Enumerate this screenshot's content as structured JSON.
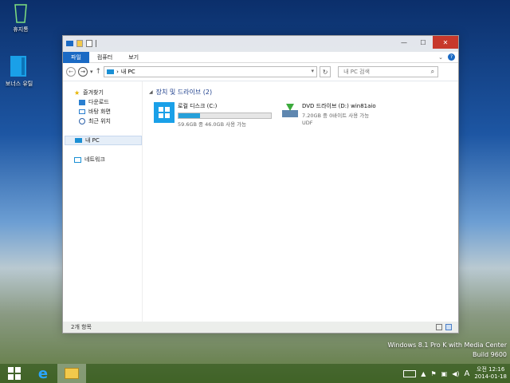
{
  "desktop": {
    "icons": [
      {
        "label": "휴지통",
        "icon": "recycle-bin-icon"
      },
      {
        "label": "보너스 유틸",
        "icon": "folder-blue-icon"
      }
    ]
  },
  "window": {
    "title_icons": [
      "this-pc-icon",
      "properties-icon",
      "new-folder-icon"
    ],
    "controls": {
      "minimize": "—",
      "maximize": "☐",
      "close": "✕"
    },
    "ribbon_tabs": [
      "파일",
      "컴퓨터",
      "보기"
    ],
    "address": {
      "back": "←",
      "forward": "→",
      "history": "▾",
      "up": "↑",
      "path_sep": "›",
      "path": "내 PC",
      "dropdown": "▾",
      "refresh": "↻"
    },
    "search": {
      "placeholder": "내 PC 검색",
      "icon": "⌕"
    },
    "nav_pane": {
      "favorites": "즐겨찾기",
      "favorites_items": [
        "다운로드",
        "바탕 화면",
        "최근 위치"
      ],
      "this_pc": "내 PC",
      "network": "네트워크"
    },
    "content": {
      "group_header": "장치 및 드라이브 (2)",
      "drives": [
        {
          "name": "로컬 디스크 (C:)",
          "detail": "59.6GB 중 46.0GB 사용 가능",
          "usage_fraction": 0.23
        },
        {
          "name": "DVD 드라이브 (D:) win81aio",
          "detail": "7.20GB 중 0바이트 사용 가능",
          "fs": "UDF"
        }
      ]
    },
    "status": {
      "items_count": "2개 항목"
    }
  },
  "watermark": {
    "line1": "Windows 8.1 Pro K with Media Center",
    "line2": "Build 9600"
  },
  "taskbar": {
    "clock_time": "오전 12:16",
    "clock_date": "2014-01-18",
    "ime": "A"
  },
  "colors": {
    "accent_blue": "#1a6ac4",
    "close_red": "#c7382b",
    "header_blue": "#1e3f8c",
    "usage_bar": "#26a0da"
  }
}
